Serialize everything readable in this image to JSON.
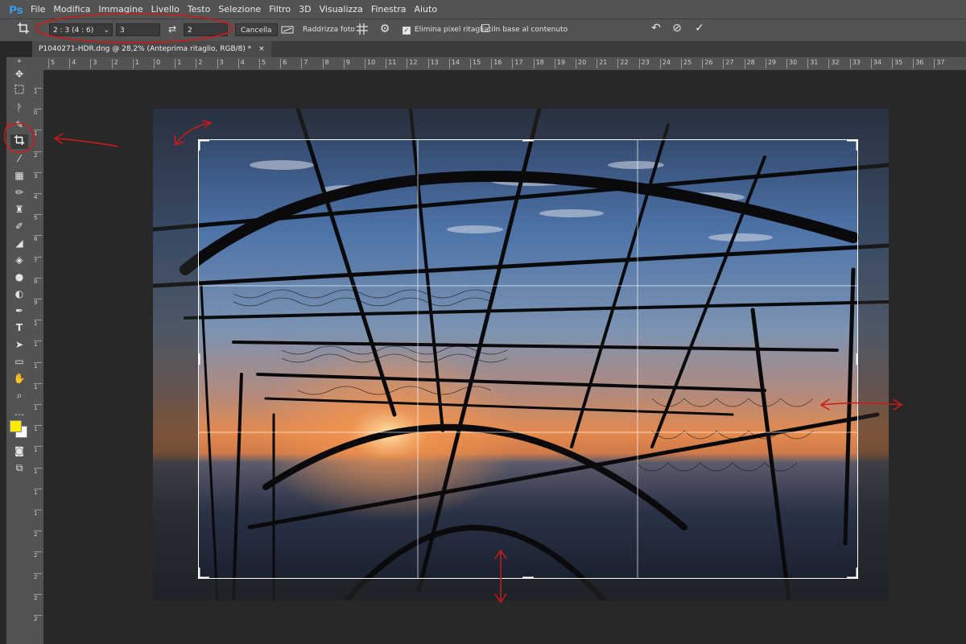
{
  "app": {
    "logo": "Ps"
  },
  "menu": [
    "File",
    "Modifica",
    "Immagine",
    "Livello",
    "Testo",
    "Selezione",
    "Filtro",
    "3D",
    "Visualizza",
    "Finestra",
    "Aiuto"
  ],
  "options": {
    "ratio_preset": "2 : 3 (4 : 6)",
    "width_value": "3",
    "height_value": "2",
    "cancel_label": "Cancella",
    "straighten_label": "Raddrizza foto",
    "delete_pixels_label": "Elimina pixel ritagliati",
    "delete_pixels_checked": true,
    "content_aware_label": "In base al contenuto",
    "content_aware_checked": false
  },
  "document": {
    "tab_title": "P1040271-HDR.dng @ 28,2% (Anteprima ritaglio, RGB/8) *",
    "close_glyph": "×"
  },
  "ruler_top": [
    "5",
    "4",
    "3",
    "2",
    "1",
    "0",
    "1",
    "2",
    "3",
    "4",
    "5",
    "6",
    "7",
    "8",
    "9",
    "10",
    "11",
    "12",
    "13",
    "14",
    "15",
    "16",
    "17",
    "18",
    "19",
    "20",
    "21",
    "22",
    "23",
    "24",
    "25",
    "26",
    "27",
    "28",
    "29",
    "30",
    "31",
    "32",
    "33",
    "34",
    "35",
    "36",
    "37"
  ],
  "ruler_left": [
    "1",
    "0",
    "1",
    "2",
    "3",
    "4",
    "5",
    "6",
    "7",
    "8",
    "9",
    "1",
    "1",
    "1",
    "1",
    "1",
    "1",
    "1",
    "1",
    "1",
    "1",
    "2",
    "2",
    "2",
    "2",
    "2"
  ],
  "colors": {
    "foreground": "#ffea00",
    "background": "#ffffff",
    "annotation": "#d01818"
  },
  "icons": {
    "crop_tool": "crop-icon",
    "swap": "swap-arrows-icon",
    "grid_overlay": "grid-icon",
    "settings": "gear-icon",
    "reset": "reset-icon",
    "cancel_crop": "cancel-icon",
    "commit_crop": "check-icon"
  }
}
